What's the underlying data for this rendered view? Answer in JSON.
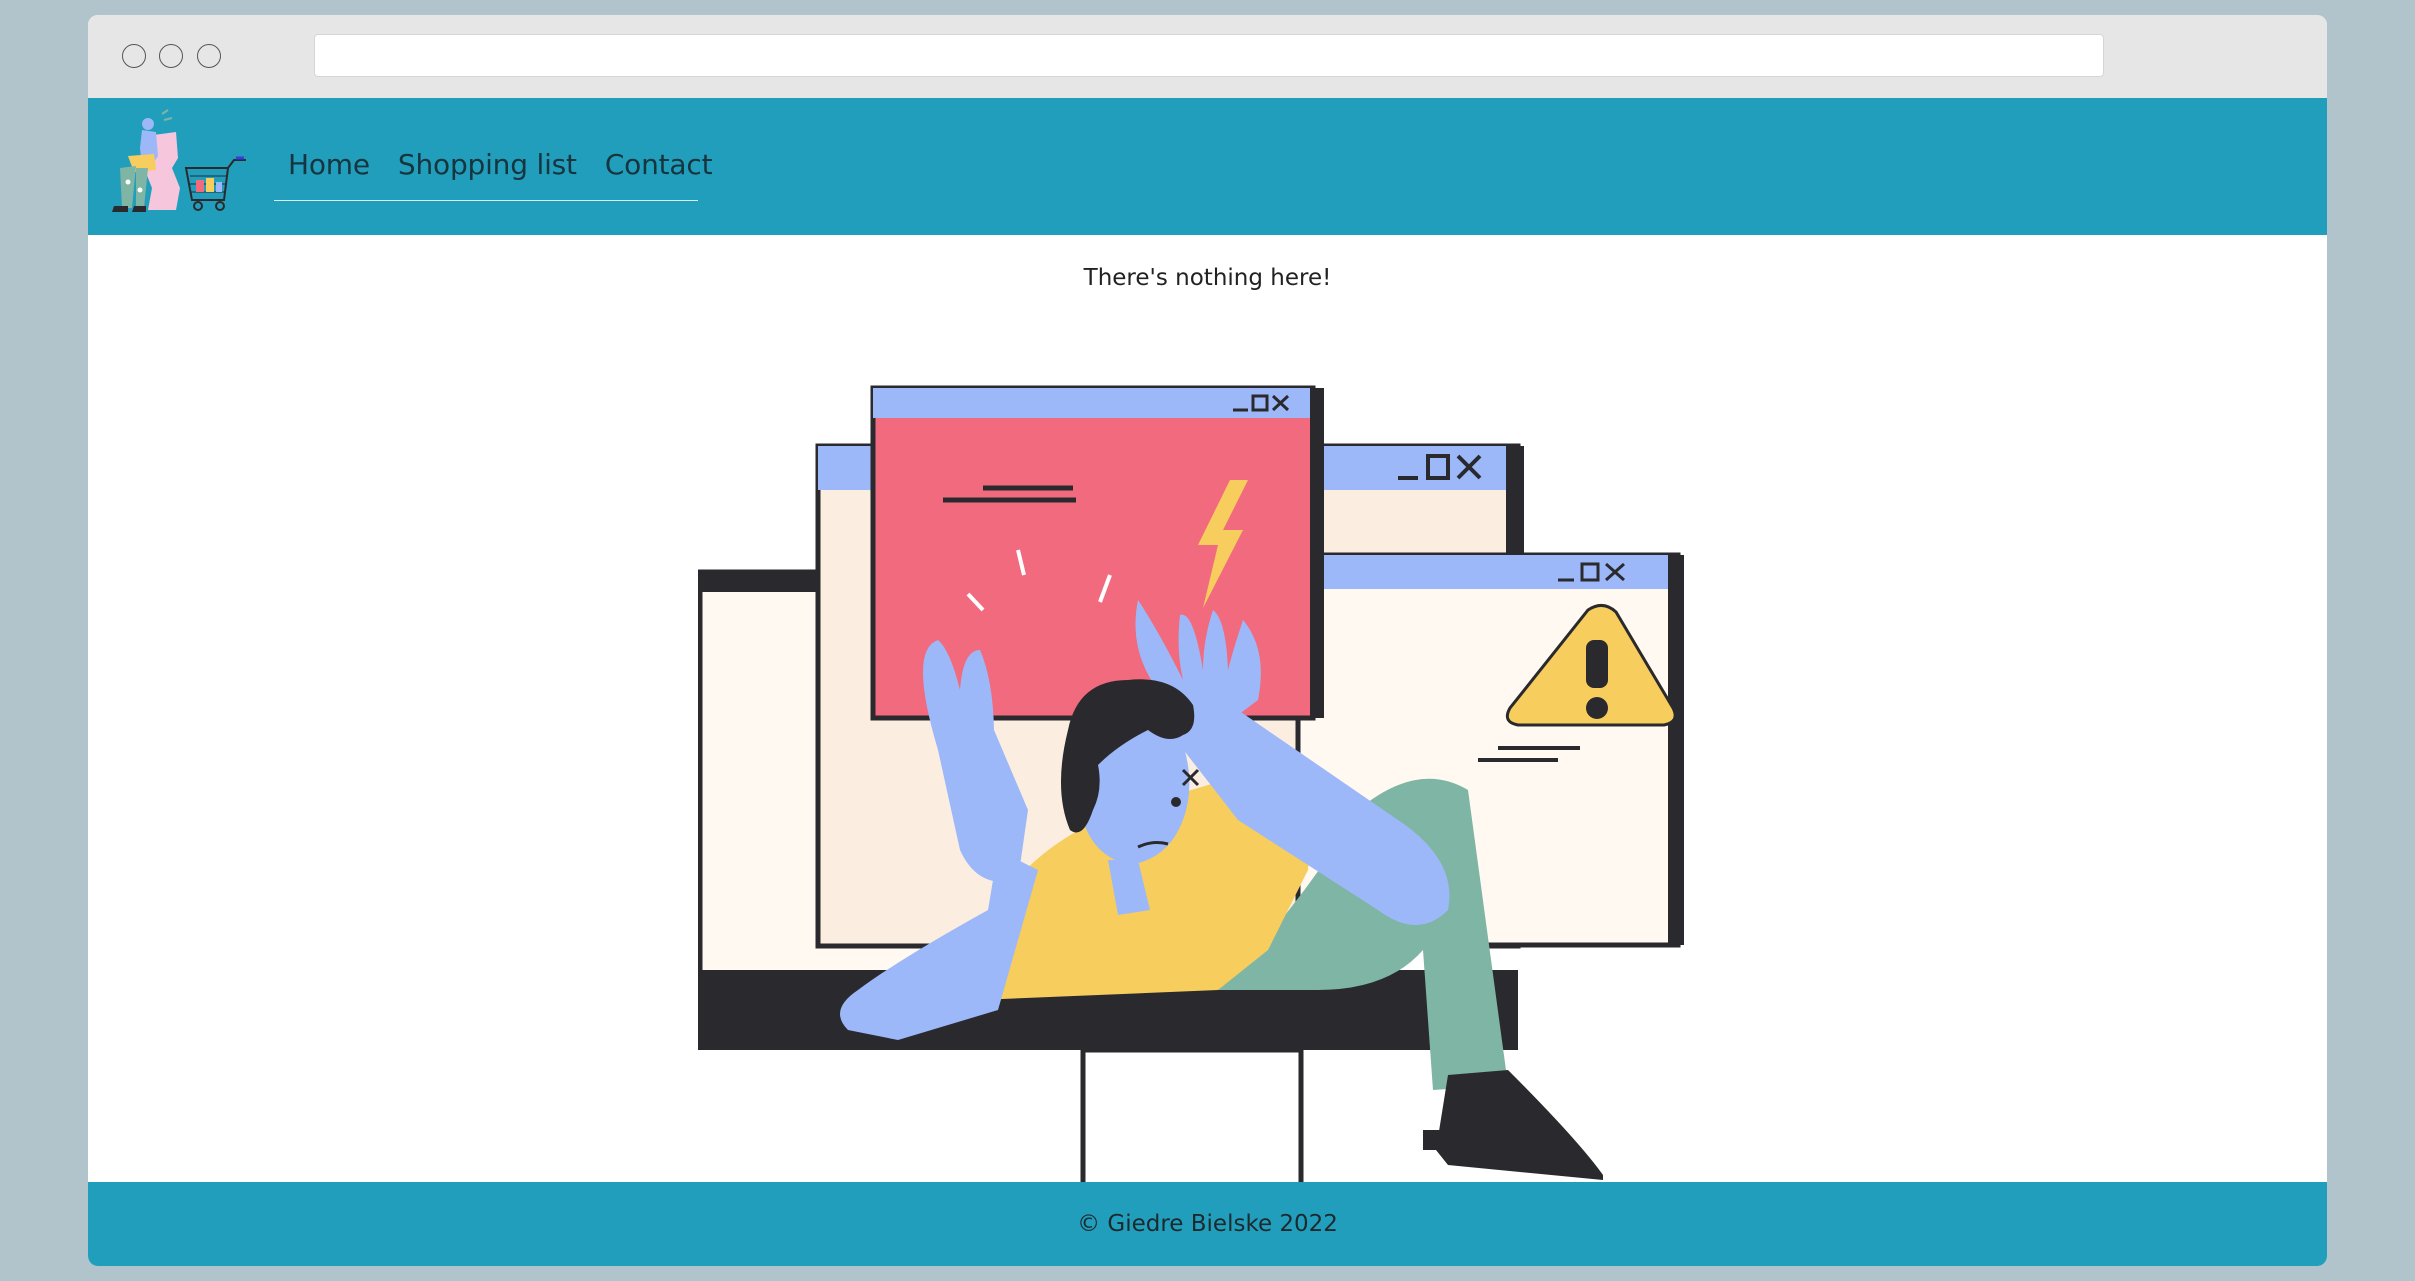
{
  "nav": {
    "links": [
      {
        "label": "Home"
      },
      {
        "label": "Shopping list"
      },
      {
        "label": "Contact"
      }
    ]
  },
  "main": {
    "message": "There's nothing here!"
  },
  "footer": {
    "text": "© Giedre Bielske 2022"
  },
  "colors": {
    "page_background": "#b1c4cc",
    "navbar": "#229ebd",
    "footer": "#229ebd",
    "error_window": "#f26a7e",
    "window_titlebar": "#9db8f8",
    "warning": "#f7ce5d"
  }
}
